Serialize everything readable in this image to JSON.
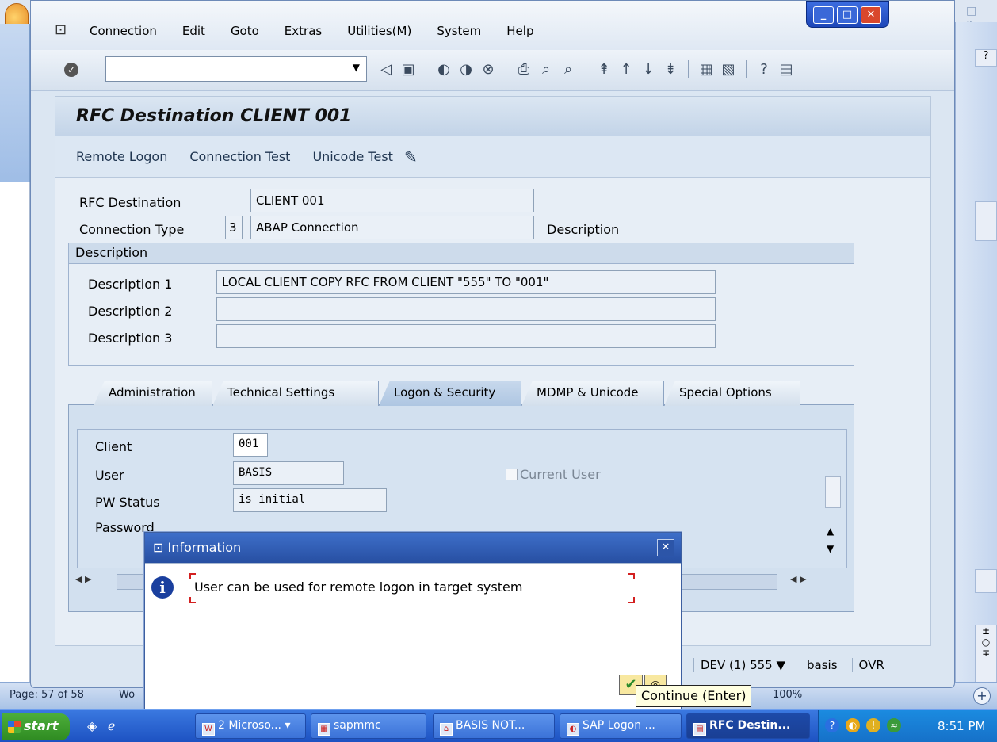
{
  "word": {
    "status_page": "Page: 57 of 58",
    "status_w": "Wo",
    "zoom": "100%"
  },
  "menubar": {
    "items": [
      "Connection",
      "Edit",
      "Goto",
      "Extras",
      "Utilities(M)",
      "System",
      "Help"
    ]
  },
  "title": "RFC Destination CLIENT 001",
  "app_toolbar": {
    "remote_logon": "Remote Logon",
    "connection_test": "Connection Test",
    "unicode_test": "Unicode Test"
  },
  "header": {
    "rfc_dest_label": "RFC Destination",
    "rfc_dest_value": "CLIENT 001",
    "conn_type_label": "Connection Type",
    "conn_type_code": "3",
    "conn_type_value": "ABAP Connection",
    "description_label": "Description"
  },
  "desc_group": {
    "title": "Description",
    "d1_label": "Description 1",
    "d1_value": "LOCAL CLIENT COPY RFC FROM  CLIENT \"555\" TO \"001\"",
    "d2_label": "Description 2",
    "d2_value": "",
    "d3_label": "Description 3",
    "d3_value": ""
  },
  "tabs": [
    "Administration",
    "Technical Settings",
    "Logon & Security",
    "MDMP & Unicode",
    "Special Options"
  ],
  "logon": {
    "client_label": "Client",
    "client_value": "001",
    "user_label": "User",
    "user_value": "BASIS",
    "current_user_label": "Current User",
    "pw_status_label": "PW Status",
    "pw_status_value": "is initial",
    "password_label": "Password"
  },
  "sap_status": {
    "system": "DEV (1) 555",
    "user": "basis",
    "mode": "OVR"
  },
  "dialog": {
    "title": "Information",
    "message": "User can be used for remote logon in target system",
    "tooltip": "Continue   (Enter)"
  },
  "taskbar": {
    "start": "start",
    "tasks": [
      "2 Microso...",
      "sapmmc",
      "BASIS NOT...",
      "SAP Logon ...",
      "RFC Destin..."
    ],
    "time": "8:51 PM"
  }
}
